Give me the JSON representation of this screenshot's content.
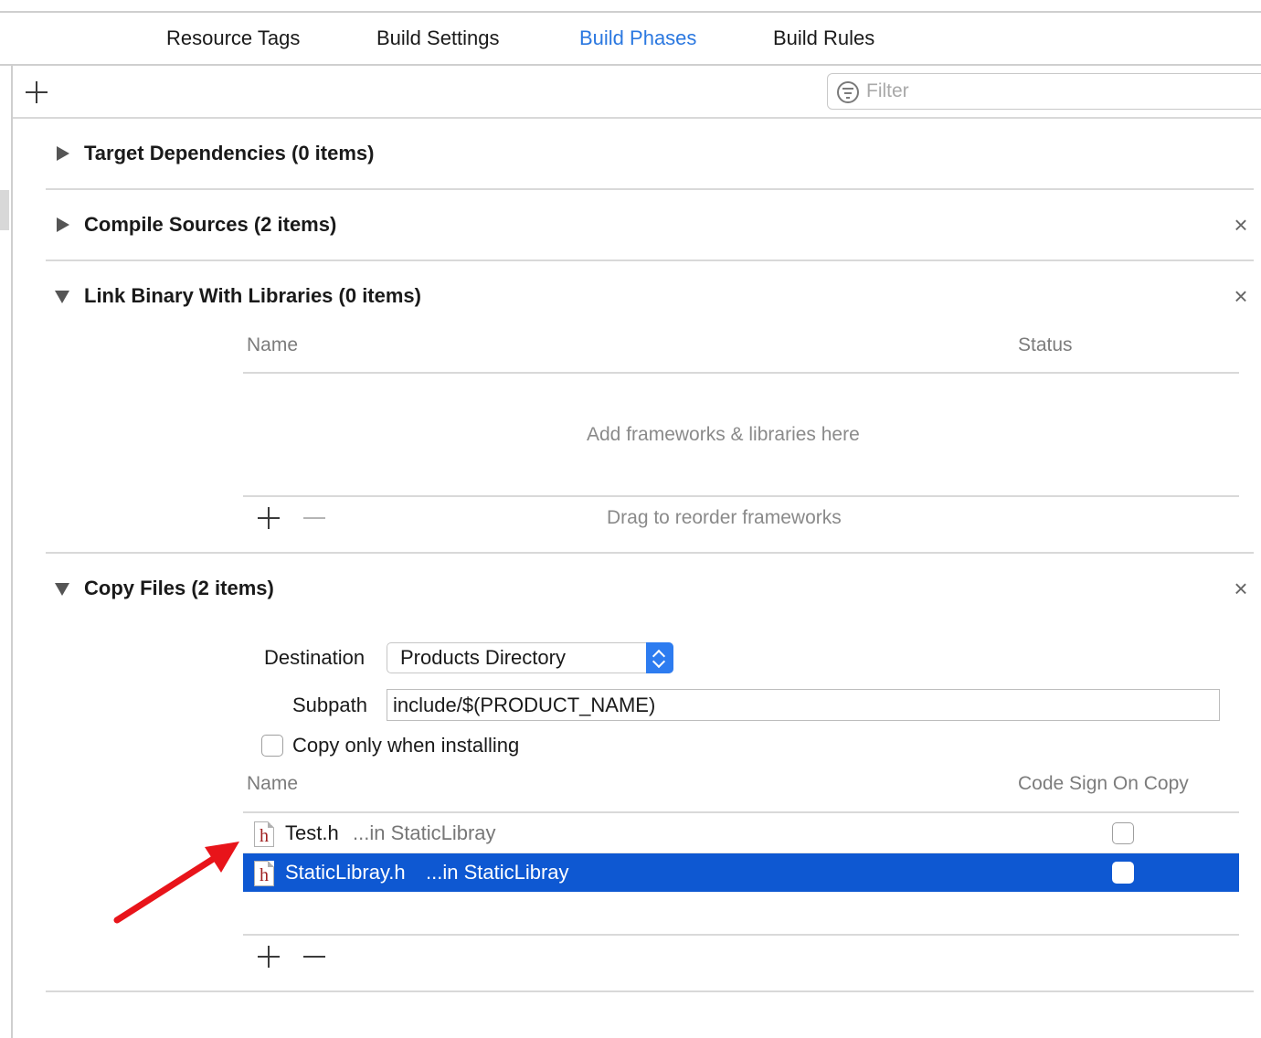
{
  "tabs": [
    {
      "label": "Resource Tags"
    },
    {
      "label": "Build Settings"
    },
    {
      "label": "Build Phases"
    },
    {
      "label": "Build Rules"
    }
  ],
  "toolbar": {
    "filter_placeholder": "Filter"
  },
  "sections": {
    "target_dependencies": {
      "title": "Target Dependencies (0 items)",
      "expanded": false
    },
    "compile_sources": {
      "title": "Compile Sources (2 items)",
      "expanded": false
    },
    "link_binary": {
      "title": "Link Binary With Libraries (0 items)",
      "expanded": true,
      "col_name": "Name",
      "col_status": "Status",
      "empty_hint": "Add frameworks & libraries here",
      "footer_hint": "Drag to reorder frameworks"
    },
    "copy_files": {
      "title": "Copy Files (2 items)",
      "expanded": true,
      "destination_label": "Destination",
      "destination_value": "Products Directory",
      "subpath_label": "Subpath",
      "subpath_value": "include/$(PRODUCT_NAME)",
      "copy_only_label": "Copy only when installing",
      "copy_only_checked": false,
      "col_name": "Name",
      "col_sign": "Code Sign On Copy",
      "files": [
        {
          "name": "Test.h",
          "location": "...in StaticLibray",
          "code_sign": false,
          "selected": false
        },
        {
          "name": "StaticLibray.h",
          "location": "...in StaticLibray",
          "code_sign": false,
          "selected": true
        }
      ]
    }
  },
  "icons": {
    "file": "h",
    "close": "×"
  },
  "colors": {
    "accent": "#2b78e0",
    "selection": "#0e58d2",
    "annotation_arrow": "#e8141a"
  }
}
